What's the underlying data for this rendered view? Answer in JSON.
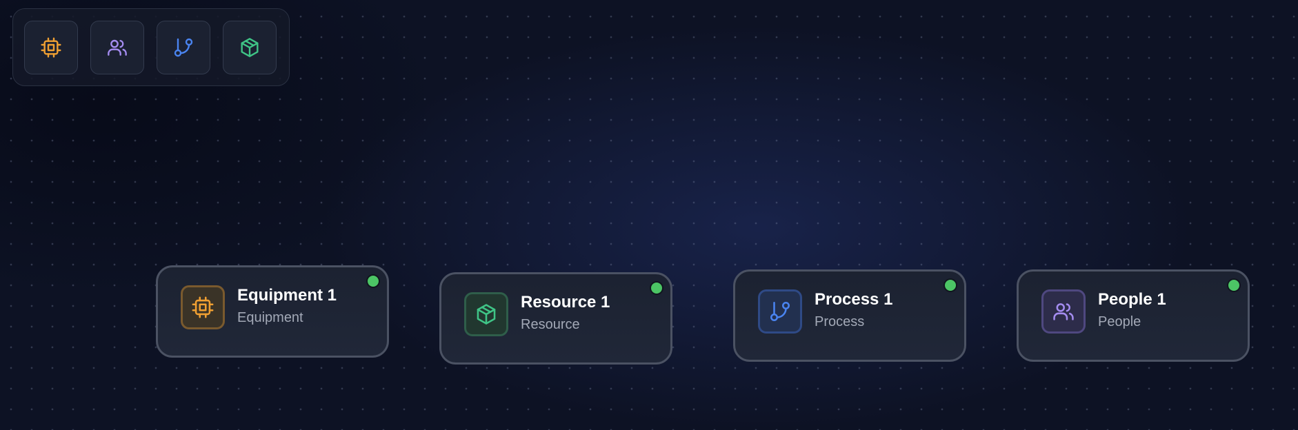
{
  "colors": {
    "equipment": "#f0a032",
    "people": "#a48cf0",
    "process": "#4a84f0",
    "resource": "#3fc486",
    "status_active": "#4cc565"
  },
  "toolbar": {
    "buttons": [
      {
        "name": "equipment",
        "icon": "cpu-icon"
      },
      {
        "name": "people",
        "icon": "users-icon"
      },
      {
        "name": "process",
        "icon": "git-branch-icon"
      },
      {
        "name": "resource",
        "icon": "package-icon"
      }
    ]
  },
  "nodes": [
    {
      "title": "Equipment 1",
      "subtitle": "Equipment",
      "icon": "cpu-icon",
      "status": "active"
    },
    {
      "title": "Resource 1",
      "subtitle": "Resource",
      "icon": "package-icon",
      "status": "active"
    },
    {
      "title": "Process 1",
      "subtitle": "Process",
      "icon": "git-branch-icon",
      "status": "active"
    },
    {
      "title": "People 1",
      "subtitle": "People",
      "icon": "users-icon",
      "status": "active"
    }
  ]
}
